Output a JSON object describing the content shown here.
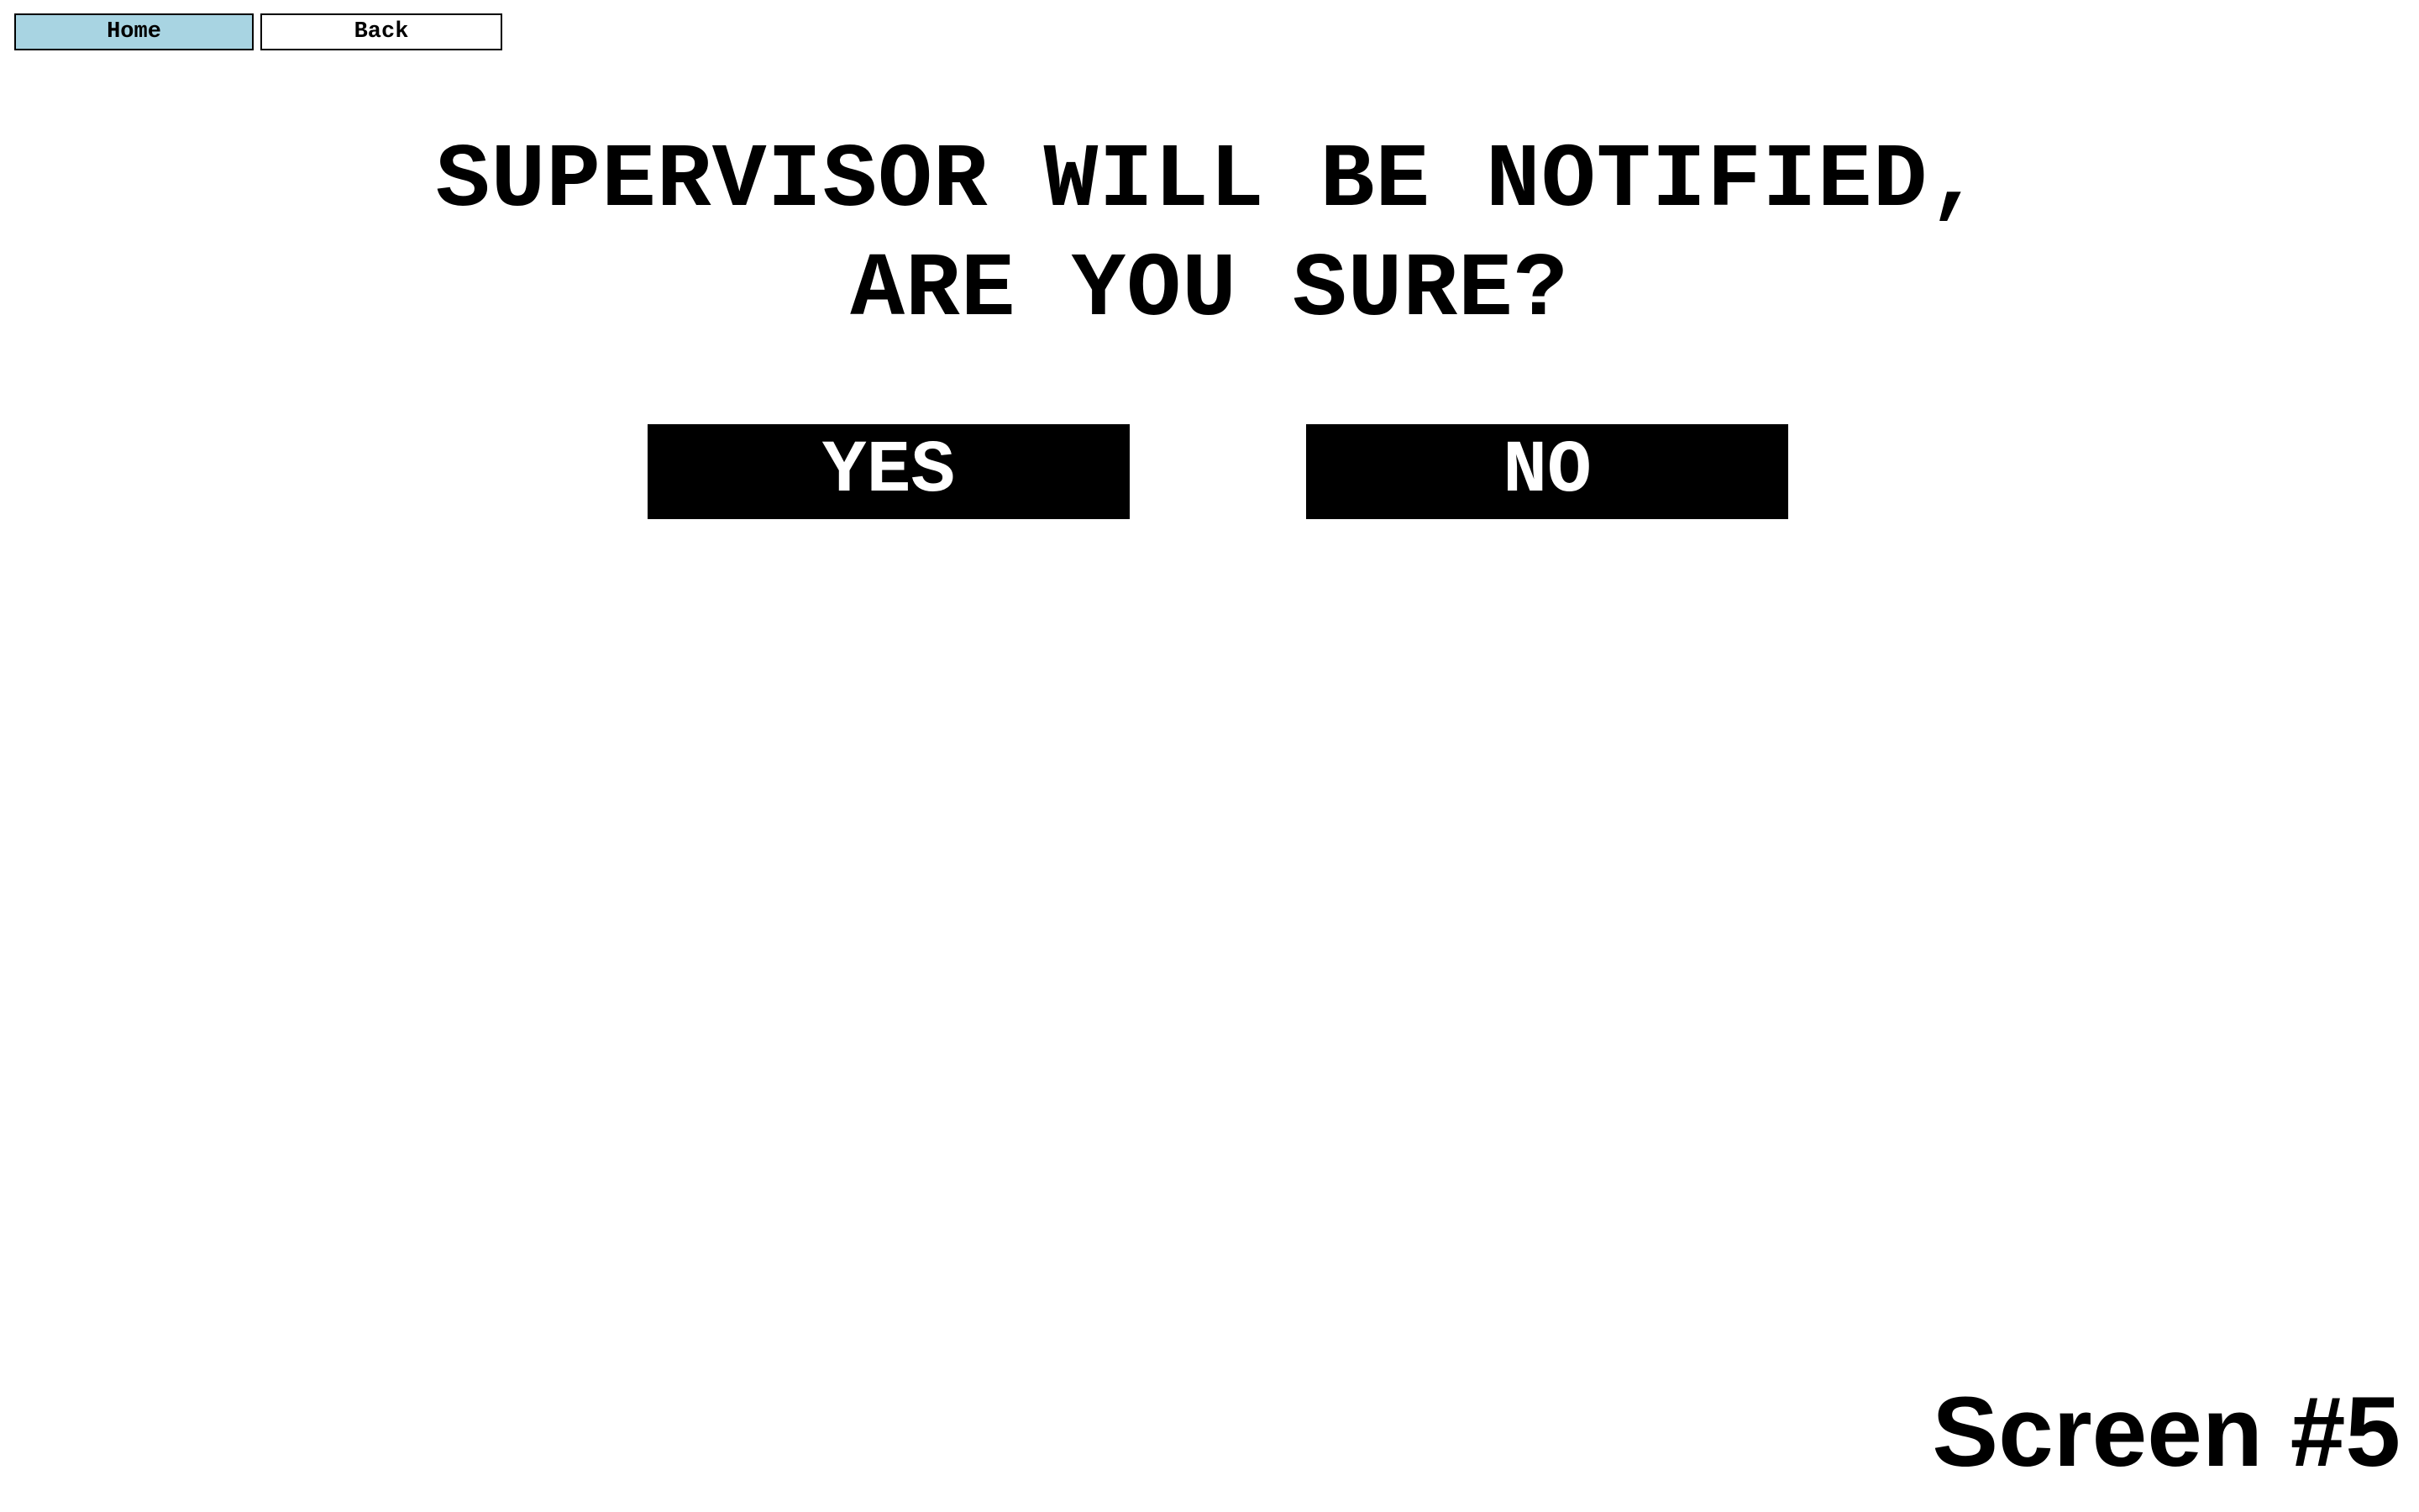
{
  "nav": {
    "home_label": "Home",
    "back_label": "Back",
    "home_bg_color": "#a8d4e2"
  },
  "dialog": {
    "line1": "SUPERVISOR WILL BE NOTIFIED,",
    "line2": "ARE YOU SURE?",
    "yes_label": "YES",
    "no_label": "NO"
  },
  "footer": {
    "screen_label": "Screen #5"
  }
}
